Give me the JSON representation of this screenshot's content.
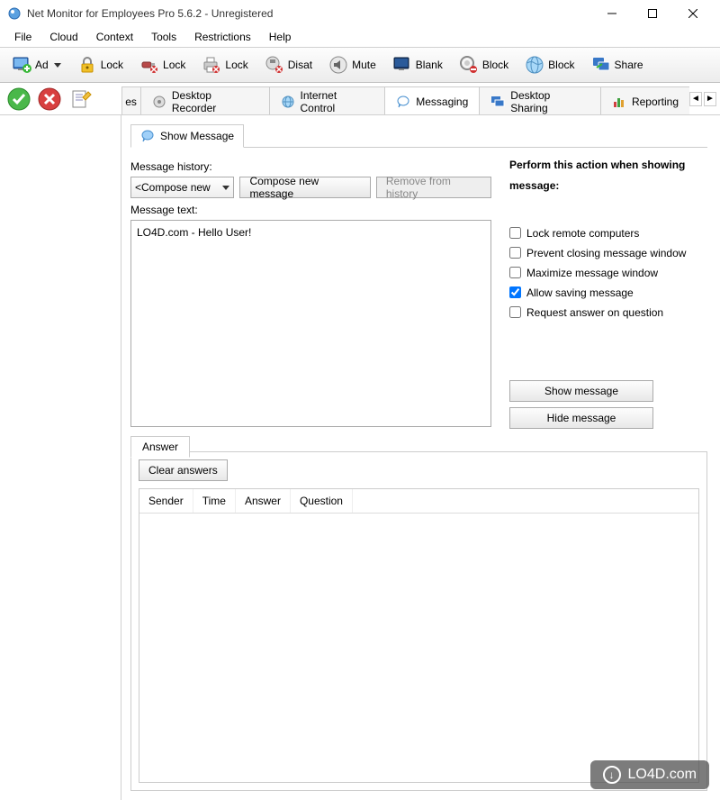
{
  "window": {
    "title": "Net Monitor for Employees Pro 5.6.2 - Unregistered"
  },
  "menu": {
    "items": [
      "File",
      "Cloud",
      "Context",
      "Tools",
      "Restrictions",
      "Help"
    ]
  },
  "toolbar": {
    "items": [
      {
        "icon": "add",
        "label": "Ad",
        "dropdown": true
      },
      {
        "icon": "lock-yellow",
        "label": "Lock"
      },
      {
        "icon": "usb-lock",
        "label": "Lock"
      },
      {
        "icon": "printer-lock",
        "label": "Lock"
      },
      {
        "icon": "disable",
        "label": "Disat"
      },
      {
        "icon": "mute",
        "label": "Mute"
      },
      {
        "icon": "monitor-blank",
        "label": "Blank"
      },
      {
        "icon": "block-gear",
        "label": "Block"
      },
      {
        "icon": "block-globe",
        "label": "Block"
      },
      {
        "icon": "share",
        "label": "Share"
      }
    ]
  },
  "tabs": {
    "partial_left": "es",
    "items": [
      {
        "icon": "recorder",
        "label": "Desktop Recorder"
      },
      {
        "icon": "globe",
        "label": "Internet Control"
      },
      {
        "icon": "chat",
        "label": "Messaging",
        "active": true
      },
      {
        "icon": "desktop-share",
        "label": "Desktop Sharing"
      },
      {
        "icon": "bars",
        "label": "Reporting"
      }
    ]
  },
  "messaging": {
    "show_message_tab": "Show Message",
    "history_label": "Message history:",
    "compose_selected": "<Compose new",
    "compose_btn": "Compose new message",
    "remove_btn": "Remove from history",
    "text_label": "Message text:",
    "text_value": "LO4D.com - Hello User!",
    "right": {
      "title": "Perform this action when showing message:",
      "options": [
        {
          "label": "Lock remote computers",
          "checked": false
        },
        {
          "label": "Prevent closing message window",
          "checked": false
        },
        {
          "label": "Maximize message window",
          "checked": false
        },
        {
          "label": "Allow saving message",
          "checked": true
        },
        {
          "label": "Request answer on question",
          "checked": false
        }
      ],
      "show_btn": "Show message",
      "hide_btn": "Hide message"
    },
    "answer": {
      "tab": "Answer",
      "clear_btn": "Clear answers",
      "columns": [
        "Sender",
        "Time",
        "Answer",
        "Question"
      ]
    }
  },
  "watermark": "LO4D.com"
}
